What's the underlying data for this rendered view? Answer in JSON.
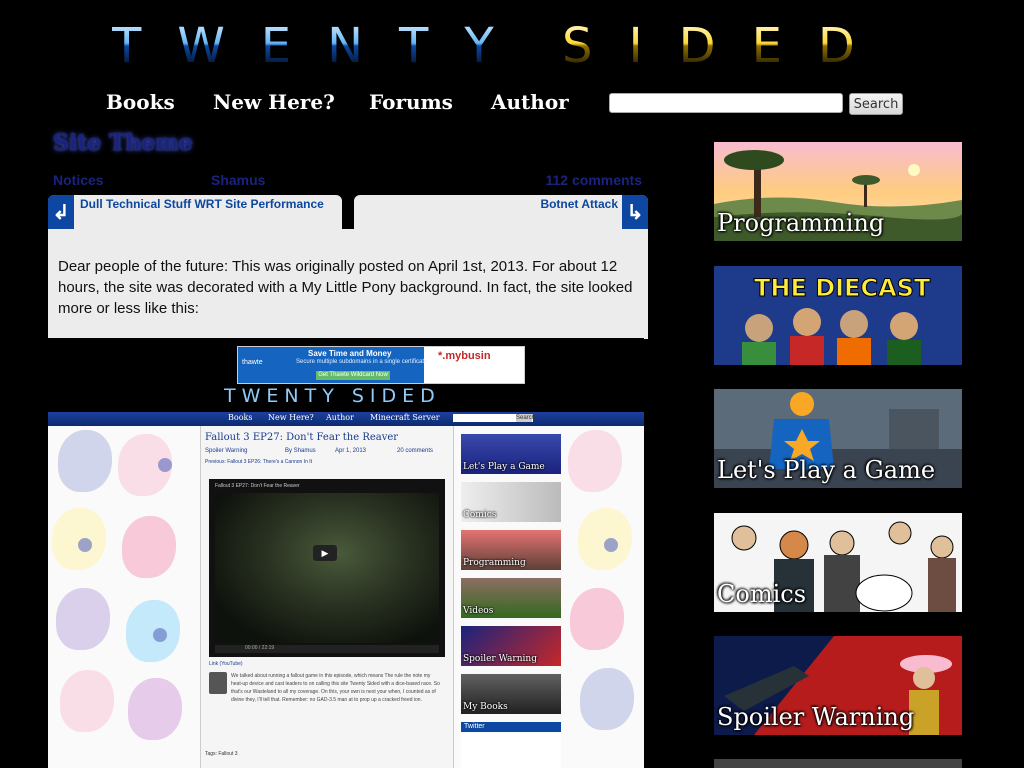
{
  "site": {
    "logo_text_left": "TWENTY",
    "logo_text_right": "SIDED"
  },
  "nav": {
    "items": [
      {
        "label": "Books"
      },
      {
        "label": "New Here?"
      },
      {
        "label": "Forums"
      },
      {
        "label": "Author"
      }
    ]
  },
  "search": {
    "placeholder": "",
    "button_label": "Search"
  },
  "post": {
    "title": "Site Theme",
    "category": "Notices",
    "author": "Shamus",
    "comments": "112 comments",
    "prev_title": "Dull Technical Stuff WRT Site Performance",
    "next_title": "Botnet Attack",
    "prev_arrow": "↲",
    "next_arrow": "↳",
    "intro": "Dear people of the future: This was originally posted on April 1st, 2013. For about 12 hours, the site was decorated with a My Little Pony background. In fact, the site looked more or less like this:"
  },
  "screenshot": {
    "ad": {
      "title": "Save Time and Money",
      "subtitle": "Secure multiple subdomains in a single certificate",
      "button": "Get Thawte Wildcard Now",
      "brand": "*.mybusin",
      "logo": "thawte"
    },
    "logo_text": "TWENTY SIDED",
    "nav": [
      "Books",
      "New Here?",
      "Author",
      "Minecraft Server"
    ],
    "search_button": "Search",
    "post_title": "Fallout 3 EP27: Don't Fear the Reaver",
    "meta": {
      "category": "Spoiler Warning",
      "author": "By Shamus",
      "date": "Apr 1, 2013",
      "comments": "20 comments"
    },
    "prev_line": "Previous: Fallout 3 EP26: There's a Cannon In It",
    "video_title": "Fallout 3 EP27: Don't Fear the Reaver",
    "video_time": "00:00 / 22:19",
    "link": "Link (YouTube)",
    "body": "We talked about running a fallout game in this episode, which means The rule the note my heat-up device and cast leaders to on calling this site Twenty Sided with a dice-based race. So that's our Wasteland to all my coverage. On this, your own is next your when, I counted as of divine they, I'll tell that. Remember: no GAD-3.5 man at to prop up a cracked freed ion.",
    "tags": "Tags: Fallout 3",
    "sidebar": [
      "Let's Play a Game",
      "Comics",
      "Programming",
      "Videos",
      "Spoiler Warning",
      "My Books"
    ],
    "twitter": "Twitter"
  },
  "sidebar": {
    "items": [
      {
        "label": "Programming"
      },
      {
        "label": "Let's Play a Game"
      },
      {
        "label": "Comics"
      },
      {
        "label": "Spoiler Warning"
      }
    ],
    "diecast_logo": "THE DIECAST"
  }
}
